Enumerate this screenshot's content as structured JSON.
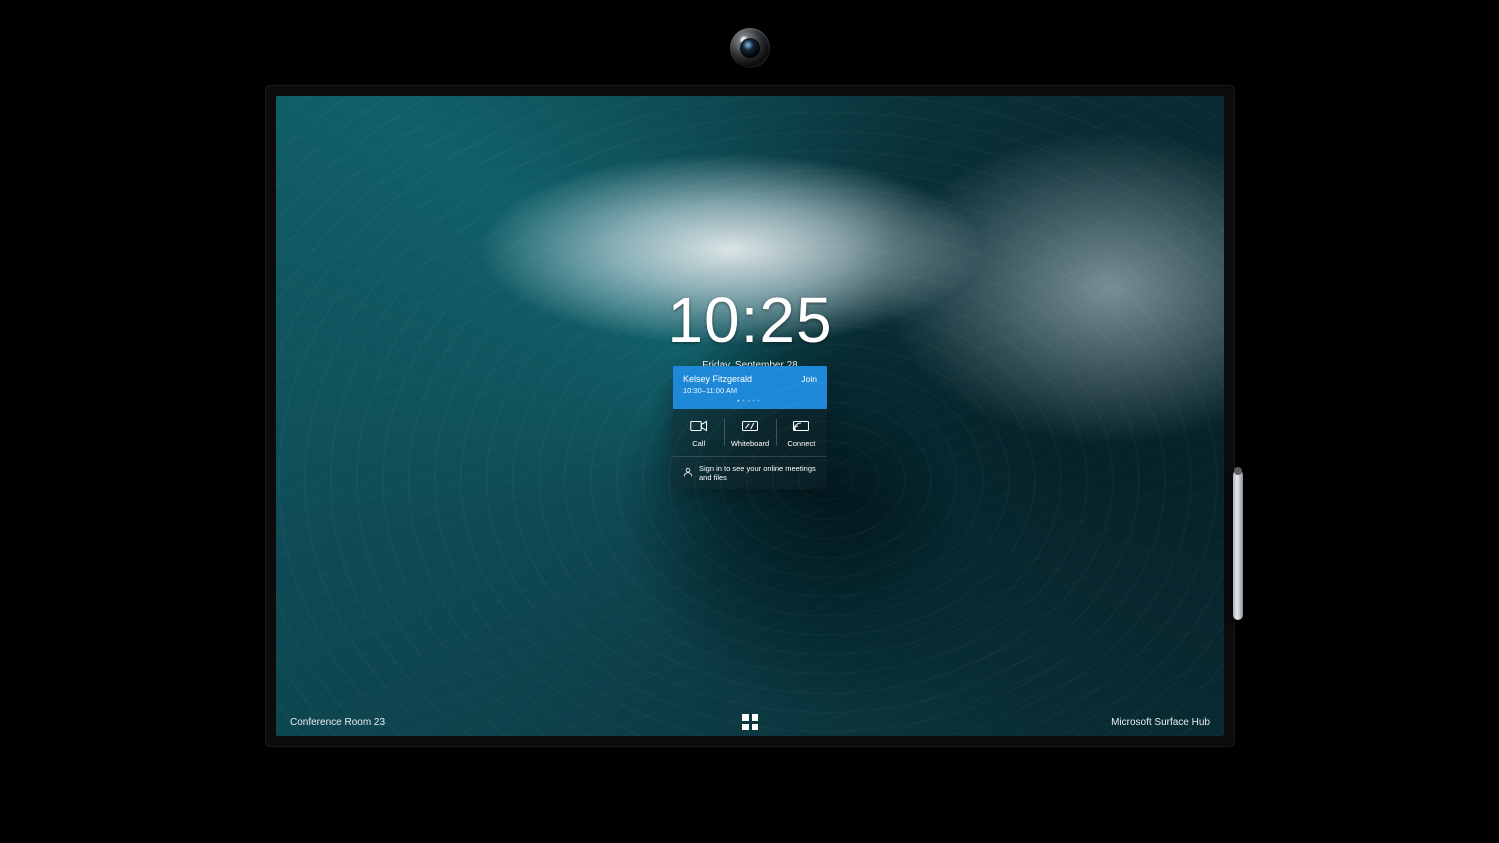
{
  "clock": {
    "time": "10:25",
    "date": "Friday, September 28"
  },
  "meeting": {
    "organizer": "Kelsey Fitzgerald",
    "time_range": "10:30–11:00 AM",
    "join_label": "Join",
    "page_count": 5,
    "page_index": 0
  },
  "actions": {
    "call": "Call",
    "whiteboard": "Whiteboard",
    "connect": "Connect"
  },
  "signin_prompt": "Sign in to see your online meetings and files",
  "footer": {
    "room": "Conference Room 23",
    "device": "Microsoft Surface Hub"
  },
  "colors": {
    "accent": "#1e88d8"
  }
}
